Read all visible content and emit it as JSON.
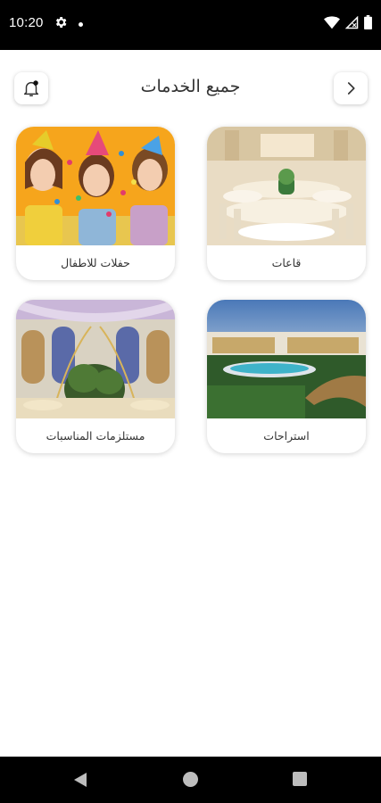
{
  "status_bar": {
    "time": "10:20",
    "icons": [
      "gear-icon",
      "notification-dot",
      "wifi-icon",
      "no-signal-icon",
      "battery-icon"
    ]
  },
  "header": {
    "title": "جميع الخدمات",
    "left_button_icon": "bell-icon",
    "right_button_icon": "chevron-right-icon"
  },
  "services": [
    {
      "label": "قاعات",
      "image": "wedding-hall-photo"
    },
    {
      "label": "حفلات للاطفال",
      "image": "kids-party-photo"
    },
    {
      "label": "استراحات",
      "image": "resort-pool-photo"
    },
    {
      "label": "مستلزمات المناسبات",
      "image": "event-decor-photo"
    }
  ],
  "nav_bar": {
    "icons": [
      "back-triangle-icon",
      "home-circle-icon",
      "recents-square-icon"
    ]
  },
  "colors": {
    "accent_yellow": "#f4a11a",
    "text": "#333333"
  }
}
